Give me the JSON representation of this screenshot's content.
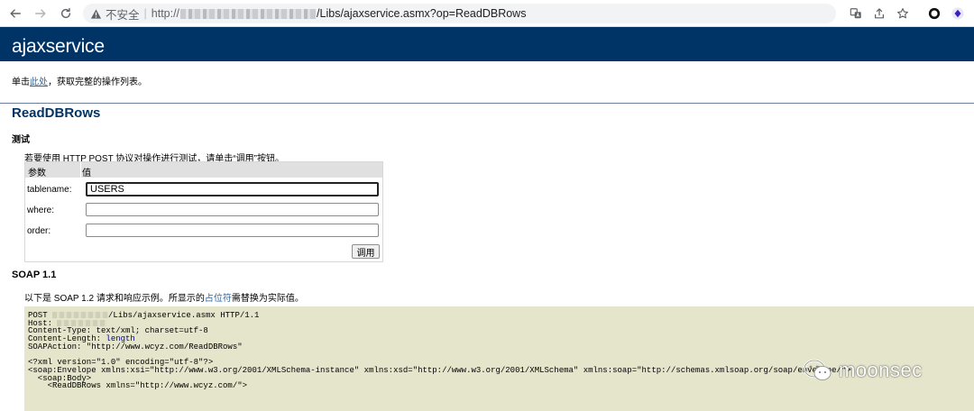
{
  "browser": {
    "insecure_label": "不安全",
    "separator": "|",
    "url_scheme": "http://",
    "url_path": "/Libs/ajaxservice.asmx?op=ReadDBRows"
  },
  "page": {
    "title": "ajaxservice",
    "intro_prefix": "单击",
    "intro_link": "此处",
    "intro_suffix": "，获取完整的操作列表。",
    "operation_title": "ReadDBRows",
    "test_heading": "测试",
    "test_desc": "若要使用 HTTP POST 协议对操作进行测试，请单击“调用”按钮。",
    "form": {
      "col_param": "参数",
      "col_value": "值",
      "params": [
        {
          "label": "tablename:",
          "value": "USERS"
        },
        {
          "label": "where:",
          "value": ""
        },
        {
          "label": "order:",
          "value": ""
        }
      ],
      "invoke_label": "调用"
    },
    "soap_heading": "SOAP 1.1",
    "soap_desc_prefix": "以下是 SOAP 1.2 请求和响应示例。所显示的",
    "soap_desc_link": "占位符",
    "soap_desc_suffix": "需替换为实际值。",
    "sample": {
      "line1_prefix": "POST ",
      "line1_suffix": "/Libs/ajaxservice.asmx HTTP/1.1",
      "line2_prefix": "Host: ",
      "line3": "Content-Type: text/xml; charset=utf-8",
      "line4_prefix": "Content-Length: ",
      "line4_placeholder": "length",
      "line5": "SOAPAction: \"http://www.wcyz.com/ReadDBRows\"",
      "line7": "<?xml version=\"1.0\" encoding=\"utf-8\"?>",
      "line8": "<soap:Envelope xmlns:xsi=\"http://www.w3.org/2001/XMLSchema-instance\" xmlns:xsd=\"http://www.w3.org/2001/XMLSchema\" xmlns:soap=\"http://schemas.xmlsoap.org/soap/envelope/\">",
      "line9": "  <soap:Body>",
      "line10": "    <ReadDBRows xmlns=\"http://www.wcyz.com/\">"
    }
  },
  "watermark": {
    "text": "moonsec"
  },
  "colors": {
    "banner": "#003366",
    "link": "#336699",
    "code_bg": "#e5e5cc"
  }
}
